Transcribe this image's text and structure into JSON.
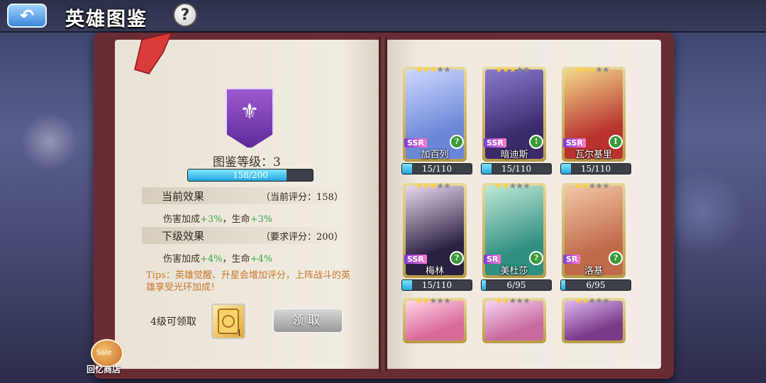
{
  "header": {
    "back_icon": "back-arrow-icon",
    "title": "英雄图鉴",
    "help_label": "?"
  },
  "collection": {
    "level_label": "图鉴等级：3",
    "progress_text": "158/200",
    "progress_fraction": 0.79,
    "current": {
      "title": "当前效果",
      "score": "（当前评分：158）",
      "effect_prefix": "伤害加成",
      "damage": "+3%",
      "sep": "，生命",
      "life": "+3%"
    },
    "next": {
      "title": "下级效果",
      "score": "（要求评分：200）",
      "effect_prefix": "伤害加成",
      "damage": "+4%",
      "sep": "，生命",
      "life": "+4%"
    },
    "tips": "Tips：英雄觉醒、升星会增加评分，上阵战斗的英雄享受光环加成！",
    "reward_label": "4级可领取",
    "reward_count": "1",
    "claim_label": "领取"
  },
  "shop": {
    "sale": "Sale",
    "label": "回忆商店"
  },
  "heroes": [
    {
      "name": "加百列",
      "rarity": "SSR",
      "stars": 3,
      "role": "?",
      "shards": "15/110",
      "shard_fraction": 0.14,
      "color_a": "#6a86d6",
      "color_b": "#cdd8ff"
    },
    {
      "name": "暗迪斯",
      "rarity": "SSR",
      "stars": 3,
      "role": "!",
      "shards": "15/110",
      "shard_fraction": 0.14,
      "color_a": "#3a2a6a",
      "color_b": "#8a7ad0"
    },
    {
      "name": "瓦尔基里",
      "rarity": "SSR",
      "stars": 3,
      "role": "I",
      "shards": "15/110",
      "shard_fraction": 0.14,
      "color_a": "#b8322e",
      "color_b": "#f2d98a"
    },
    {
      "name": "梅林",
      "rarity": "SSR",
      "stars": 3,
      "role": "?",
      "shards": "15/110",
      "shard_fraction": 0.14,
      "color_a": "#2a2040",
      "color_b": "#e8d8f0"
    },
    {
      "name": "美杜莎",
      "rarity": "SR",
      "stars": 2,
      "role": "?",
      "shards": "6/95",
      "shard_fraction": 0.06,
      "color_a": "#2f8f80",
      "color_b": "#bfe8d8"
    },
    {
      "name": "洛基",
      "rarity": "SR",
      "stars": 2,
      "role": "?",
      "shards": "6/95",
      "shard_fraction": 0.06,
      "color_a": "#c06a4a",
      "color_b": "#f2c8a6"
    },
    {
      "name": "",
      "rarity": "",
      "stars": 2,
      "role": "",
      "shards": "",
      "shard_fraction": 0,
      "color_a": "#d86a9a",
      "color_b": "#ffd6e6"
    },
    {
      "name": "",
      "rarity": "",
      "stars": 2,
      "role": "",
      "shards": "",
      "shard_fraction": 0,
      "color_a": "#c86aa0",
      "color_b": "#f6d6f0"
    },
    {
      "name": "",
      "rarity": "",
      "stars": 2,
      "role": "",
      "shards": "",
      "shard_fraction": 0,
      "color_a": "#7a3a8a",
      "color_b": "#e0b8f0"
    }
  ]
}
